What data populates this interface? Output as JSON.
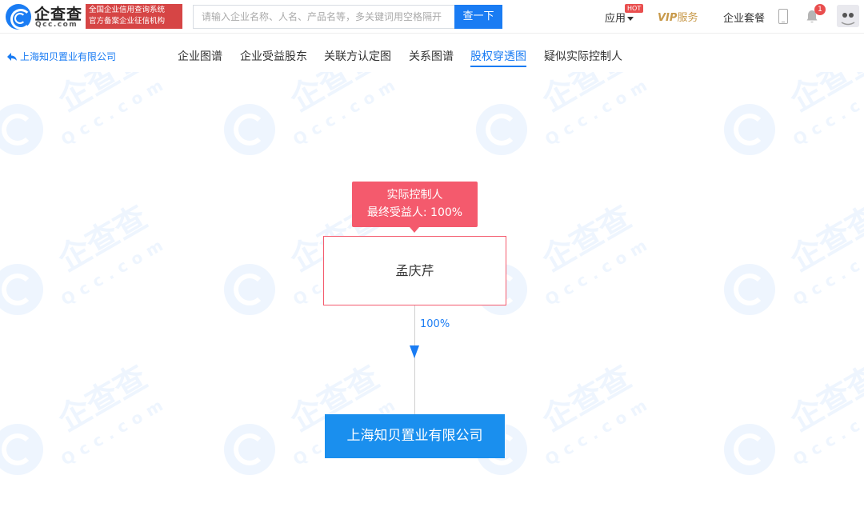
{
  "header": {
    "logo_cn": "企查查",
    "logo_en": "Qcc.com",
    "logo_badge_line1": "全国企业信用查询系统",
    "logo_badge_line2": "官方备案企业征信机构",
    "search_placeholder": "请输入企业名称、人名、产品名等，多关键词用空格隔开",
    "search_button": "查一下",
    "apps_label": "应用",
    "hot_badge": "HOT",
    "vip_prefix": "VIP",
    "vip_suffix": "服务",
    "suite_label": "企业套餐",
    "notification_count": "1"
  },
  "subnav": {
    "back_label": "上海知贝置业有限公司",
    "tabs": [
      {
        "label": "企业图谱",
        "active": false
      },
      {
        "label": "企业受益股东",
        "active": false
      },
      {
        "label": "关联方认定图",
        "active": false
      },
      {
        "label": "关系图谱",
        "active": false
      },
      {
        "label": "股权穿透图",
        "active": true
      },
      {
        "label": "疑似实际控制人",
        "active": false
      }
    ]
  },
  "watermark": {
    "cn": "企查查",
    "en": "Qcc.com"
  },
  "diagram": {
    "tooltip_line1": "实际控制人",
    "tooltip_line2": "最终受益人: 100%",
    "person_name": "孟庆芹",
    "edge_percent": "100%",
    "company_name": "上海知贝置业有限公司"
  },
  "colors": {
    "primary": "#1a7cf3",
    "controller": "#f45a6d",
    "company_fill": "#1a8fee",
    "vip_gold": "#c89a4b"
  },
  "icons": {
    "logo": "qcc-logo-icon",
    "back": "back-arrow-icon",
    "apps_caret": "caret-down-icon",
    "phone": "phone-icon",
    "bell": "bell-icon",
    "avatar": "avatar-icon"
  }
}
